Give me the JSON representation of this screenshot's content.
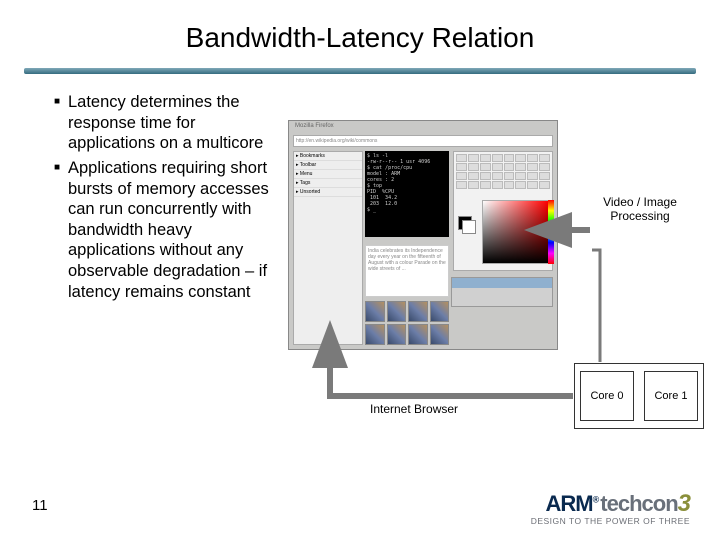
{
  "slide": {
    "title": "Bandwidth-Latency Relation",
    "page_number": "11"
  },
  "bullets": [
    "Latency determines the response time for applications on a multicore",
    "Applications requiring short bursts of memory accesses can run concurrently with bandwidth heavy applications without any observable degradation – if latency remains constant"
  ],
  "labels": {
    "video_image_processing": "Video / Image Processing",
    "internet_browser": "Internet Browser",
    "core0": "Core 0",
    "core1": "Core 1"
  },
  "footer": {
    "arm": "ARM",
    "reg": "®",
    "techcon": "techcon",
    "three": "3",
    "tagline": "DESIGN TO THE POWER OF THREE"
  },
  "figure": {
    "terminal_text": "$ ls -l\n-rw-r--r-- 1 usr 4096\n$ cat /proc/cpu\nmodel : ARM\ncores : 2\n$ top\nPID  %CPU\n 101  34.2\n 203  12.0\n$ _",
    "doc_text": "India celebrates its Independence day every year on the fifteenth of August with a colour Parade on the wide streets of ..."
  }
}
